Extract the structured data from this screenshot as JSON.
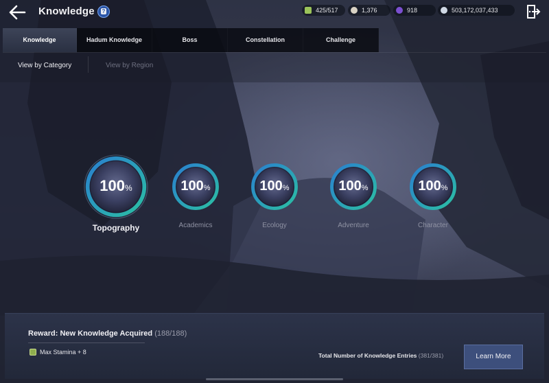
{
  "header": {
    "title": "Knowledge",
    "currencies": [
      {
        "icon": "energy-icon",
        "value": "425/517",
        "color": "#9bc45a"
      },
      {
        "icon": "pearl-icon",
        "value": "1,376",
        "color": "#d9d2c4"
      },
      {
        "icon": "crystal-icon",
        "value": "918",
        "color": "#7b4fd0"
      },
      {
        "icon": "silver-icon",
        "value": "503,172,037,433",
        "color": "#cfd8e4"
      }
    ]
  },
  "tabs": [
    "Knowledge",
    "Hadum Knowledge",
    "Boss",
    "Constellation",
    "Challenge"
  ],
  "active_tab": "Knowledge",
  "subtabs": {
    "by_category": "View by Category",
    "by_region": "View by Region"
  },
  "categories": [
    {
      "label": "Topography",
      "value": "100",
      "unit": "%",
      "selected": true
    },
    {
      "label": "Academics",
      "value": "100",
      "unit": "%",
      "selected": false
    },
    {
      "label": "Ecology",
      "value": "100",
      "unit": "%",
      "selected": false
    },
    {
      "label": "Adventure",
      "value": "100",
      "unit": "%",
      "selected": false
    },
    {
      "label": "Character",
      "value": "100",
      "unit": "%",
      "selected": false
    }
  ],
  "reward": {
    "title": "Reward: New Knowledge Acquired",
    "count": "(188/188)",
    "item": "Max Stamina + 8"
  },
  "total": {
    "label": "Total Number of Knowledge Entries",
    "count": "(381/381)"
  },
  "learn_more": "Learn More",
  "colors": {
    "ring_teal": "#2bbfa3",
    "ring_blue": "#2a7fd0",
    "accent_button": "#3d4f7c"
  }
}
